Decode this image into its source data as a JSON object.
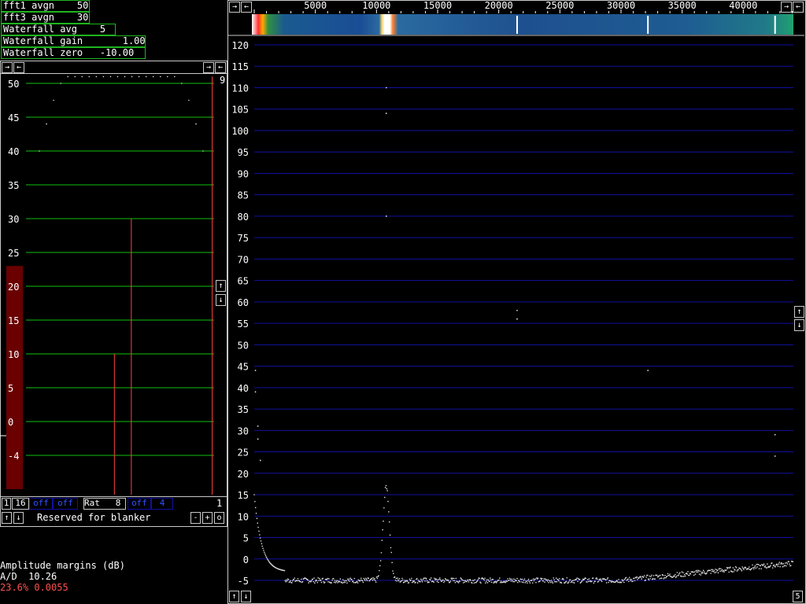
{
  "params": [
    {
      "label": "fft1 avgn    50"
    },
    {
      "label": "fft3 avgn    30"
    },
    {
      "label": "Waterfall avg    5"
    },
    {
      "label": "Waterfall gain       1.00"
    },
    {
      "label": "Waterfall zero   -10.00"
    }
  ],
  "left_panel": {
    "nav_right": "→",
    "nav_left": "←",
    "top_right_value": "9",
    "y_ticks": [
      "50",
      "45",
      "40",
      "35",
      "30",
      "25",
      "20",
      "15",
      "10",
      "5",
      "0",
      "-4"
    ],
    "y_values": [
      50,
      45,
      40,
      35,
      30,
      25,
      20,
      15,
      10,
      5,
      0,
      -5
    ],
    "dot_curve": [
      40,
      44,
      47.5,
      50,
      51,
      51,
      51,
      51,
      51,
      51,
      51,
      51,
      51,
      51,
      51,
      51,
      51,
      51,
      51,
      51,
      50,
      47.5,
      44,
      40
    ],
    "signal_bar_bottom_db": -10,
    "signal_bar_top_db": 23,
    "red_lines": [
      {
        "x_frac": 0.56,
        "top_db": 30
      },
      {
        "x_frac": 0.47,
        "top_db": 10
      },
      {
        "x_frac": 0.99,
        "top_db": 51
      }
    ],
    "bottom_row": [
      {
        "id": "b1",
        "text": "1"
      },
      {
        "id": "b16",
        "text": "16"
      },
      {
        "id": "off1",
        "text": "off"
      },
      {
        "id": "off2",
        "text": "off"
      },
      {
        "id": "rat",
        "text": "Rat   8"
      },
      {
        "id": "off3",
        "text": "off"
      },
      {
        "id": "val4",
        "text": "4"
      }
    ],
    "bottom_right_value": "1",
    "blanker_label": "Reserved for blanker",
    "minus_label": "-",
    "plus_label": "+",
    "o_label": "o",
    "up_arrow": "↑",
    "down_arrow": "↓"
  },
  "amplitude": {
    "title": "Amplitude margins (dB)",
    "ad": "A/D  10.26",
    "pct": "23.6% 0.0055",
    "pct_color": "#ff5050"
  },
  "spectrum": {
    "x_ticks": [
      "5000",
      "10000",
      "15000",
      "20000",
      "25000",
      "30000",
      "35000",
      "40000"
    ],
    "x_values": [
      5000,
      10000,
      15000,
      20000,
      25000,
      30000,
      35000,
      40000
    ],
    "x_range": [
      0,
      44100
    ],
    "nav_left": "←",
    "nav_right": "→",
    "y_ticks": [
      "120",
      "115",
      "110",
      "105",
      "100",
      "95",
      "90",
      "85",
      "80",
      "75",
      "70",
      "65",
      "60",
      "55",
      "50",
      "45",
      "40",
      "35",
      "30",
      "25",
      "20",
      "15",
      "10",
      "5",
      "0",
      "-5"
    ],
    "y_values": [
      120,
      115,
      110,
      105,
      100,
      95,
      90,
      85,
      80,
      75,
      70,
      65,
      60,
      55,
      50,
      45,
      40,
      35,
      30,
      25,
      20,
      15,
      10,
      5,
      0,
      -5
    ],
    "up_arrow": "↑",
    "down_arrow": "↓",
    "bottom_right_value": "5",
    "peak_center_hz": 10800,
    "peak_height_db": 17,
    "noise_floor_db": -5
  },
  "colors": {
    "panel_border": "#c8c8c8",
    "green_grid": "#10c010",
    "blue_grid": "#1010a0",
    "param_border": "#1fb51f",
    "red_line": "#ff4040",
    "signal_bar": "#6a0000",
    "off_text": "#3050ff"
  }
}
